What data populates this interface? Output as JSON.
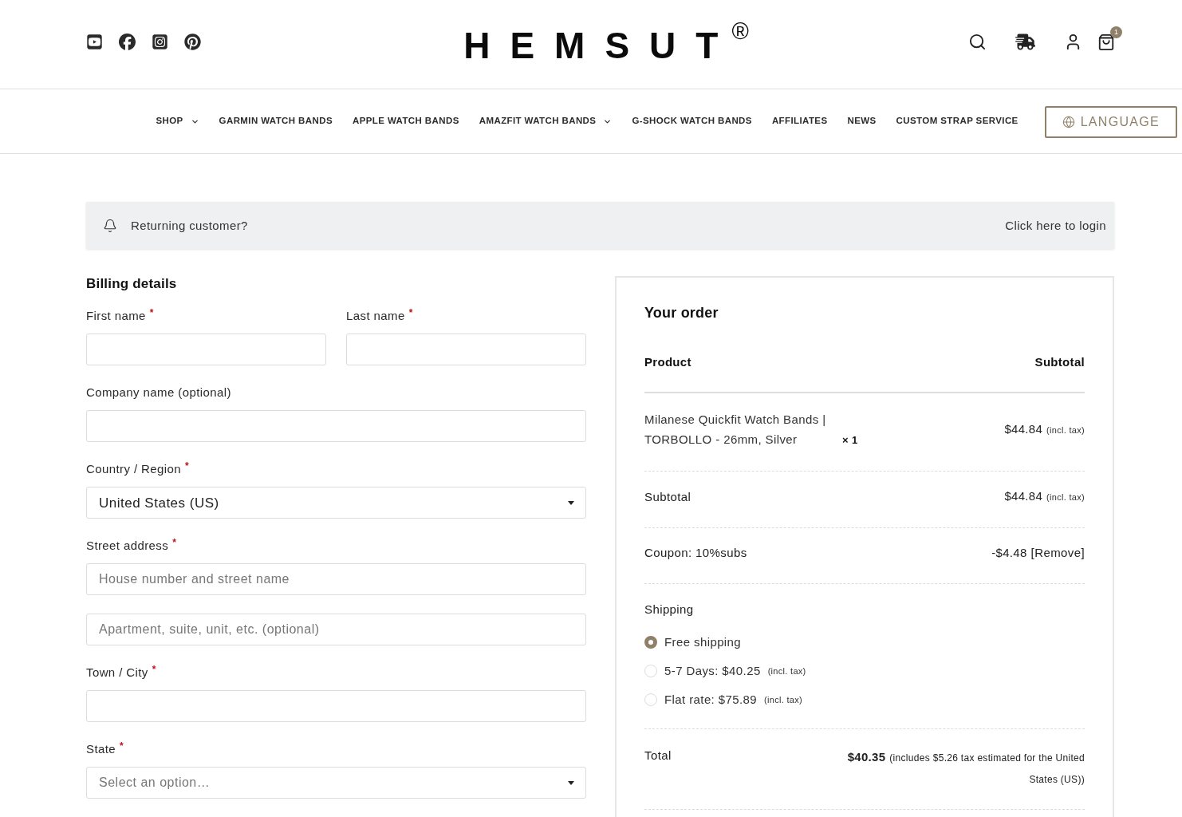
{
  "header": {
    "logo": {
      "name": "HEMSUT",
      "mark": "®"
    },
    "cart_count": "1"
  },
  "nav": {
    "items": [
      {
        "label": "SHOP",
        "has_dropdown": true
      },
      {
        "label": "GARMIN WATCH BANDS",
        "has_dropdown": false
      },
      {
        "label": "APPLE WATCH BANDS",
        "has_dropdown": false
      },
      {
        "label": "AMAZFIT WATCH BANDS",
        "has_dropdown": true
      },
      {
        "label": "G-SHOCK WATCH BANDS",
        "has_dropdown": false
      },
      {
        "label": "AFFILIATES",
        "has_dropdown": false
      },
      {
        "label": "NEWS",
        "has_dropdown": false
      },
      {
        "label": "CUSTOM STRAP SERVICE",
        "has_dropdown": false
      }
    ],
    "language_button": "LANGUAGE"
  },
  "notice": {
    "text": "Returning customer?",
    "link": "Click here to login"
  },
  "billing": {
    "title": "Billing details",
    "required_mark": "*",
    "rows": [
      [
        {
          "kind": "text",
          "label": "First name",
          "required": true
        },
        {
          "kind": "text",
          "label": "Last name",
          "required": true
        }
      ],
      [
        {
          "kind": "text",
          "label": "Company name (optional)",
          "required": false
        }
      ],
      [
        {
          "kind": "select",
          "label": "Country / Region",
          "required": true,
          "value": "United States (US)"
        }
      ],
      [
        {
          "kind": "text",
          "label": "Street address",
          "required": true,
          "placeholder": "House number and street name"
        }
      ],
      [
        {
          "kind": "text",
          "required": false,
          "placeholder": "Apartment, suite, unit, etc. (optional)"
        }
      ],
      [
        {
          "kind": "text",
          "label": "Town / City",
          "required": true
        }
      ],
      [
        {
          "kind": "select",
          "label": "State",
          "required": true,
          "placeholder": "Select an option…"
        }
      ]
    ]
  },
  "order": {
    "title": "Your order",
    "columns": [
      "Product",
      "Subtotal"
    ],
    "items": [
      {
        "name": "Milanese Quickfit Watch Bands | TORBOLLO - 26mm, Silver",
        "quantity": "× 1",
        "price": "$44.84",
        "tax_note": "(incl. tax)"
      }
    ],
    "subtotal": {
      "label": "Subtotal",
      "amount": "$44.84",
      "tax_note": "(incl. tax)"
    },
    "coupon": {
      "label": "Coupon: 10%subs",
      "amount": "-$4.48",
      "remove_link": "[Remove]"
    },
    "shipping": {
      "label": "Shipping",
      "options": [
        {
          "label": "Free shipping",
          "selected": true
        },
        {
          "label": "5-7 Days: $40.25",
          "tax_note": "(incl. tax)",
          "selected": false
        },
        {
          "label": "Flat rate: $75.89",
          "tax_note": "(incl. tax)",
          "selected": false
        }
      ]
    },
    "total": {
      "label": "Total",
      "amount": "$40.35",
      "tax_note": "(includes $5.26 tax estimated for the United States (US))"
    }
  }
}
